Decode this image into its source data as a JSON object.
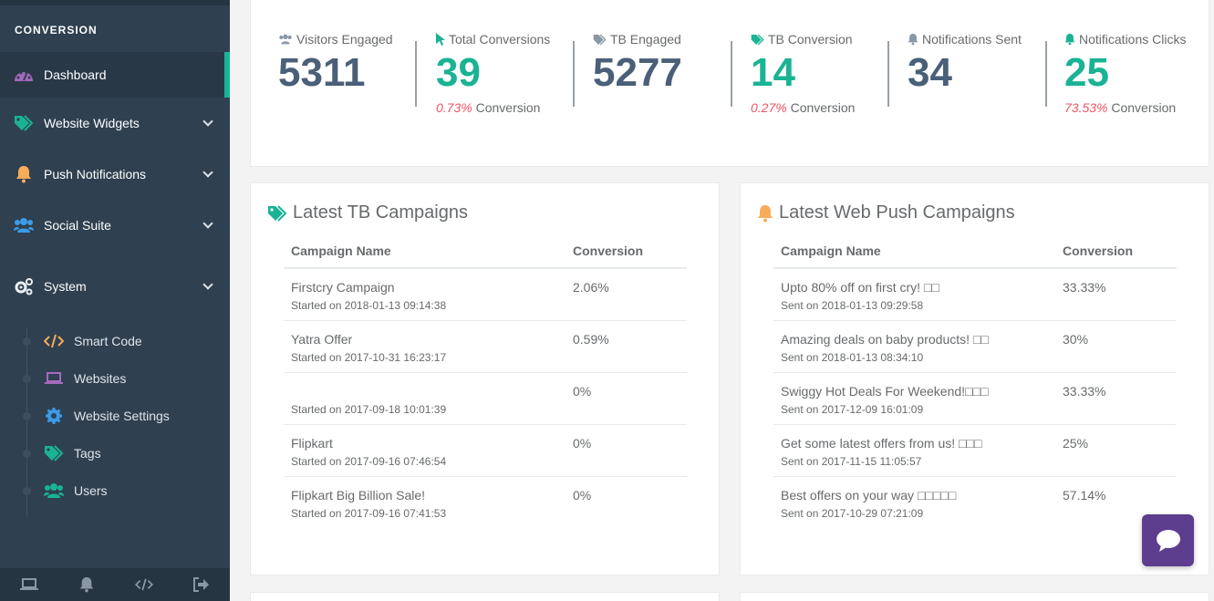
{
  "sidebar": {
    "section_title": "CONVERSION",
    "items": [
      {
        "label": "Dashboard"
      },
      {
        "label": "Website Widgets"
      },
      {
        "label": "Push Notifications"
      },
      {
        "label": "Social Suite"
      },
      {
        "label": "System"
      }
    ],
    "system_sub": [
      {
        "label": "Smart Code"
      },
      {
        "label": "Websites"
      },
      {
        "label": "Website Settings"
      },
      {
        "label": "Tags"
      },
      {
        "label": "Users"
      }
    ]
  },
  "stats": [
    {
      "label": "Visitors Engaged",
      "value": "5311",
      "pct": "",
      "sub": ""
    },
    {
      "label": "Total Conversions",
      "value": "39",
      "pct": "0.73%",
      "sub": "Conversion"
    },
    {
      "label": "TB Engaged",
      "value": "5277",
      "pct": "",
      "sub": ""
    },
    {
      "label": "TB Conversion",
      "value": "14",
      "pct": "0.27%",
      "sub": "Conversion"
    },
    {
      "label": "Notifications Sent",
      "value": "34",
      "pct": "",
      "sub": ""
    },
    {
      "label": "Notifications Clicks",
      "value": "25",
      "pct": "73.53%",
      "sub": "Conversion"
    }
  ],
  "tb_campaigns": {
    "title": "Latest TB Campaigns",
    "col_name": "Campaign Name",
    "col_conv": "Conversion",
    "rows": [
      {
        "name": "Firstcry Campaign",
        "date": "Started on 2018-01-13 09:14:38",
        "conv": "2.06%"
      },
      {
        "name": "Yatra Offer",
        "date": "Started on 2017-10-31 16:23:17",
        "conv": "0.59%"
      },
      {
        "name": "",
        "date": "Started on 2017-09-18 10:01:39",
        "conv": "0%"
      },
      {
        "name": "Flipkart",
        "date": "Started on 2017-09-16 07:46:54",
        "conv": "0%"
      },
      {
        "name": "Flipkart Big Billion Sale!",
        "date": "Started on 2017-09-16 07:41:53",
        "conv": "0%"
      }
    ]
  },
  "push_campaigns": {
    "title": "Latest Web Push Campaigns",
    "col_name": "Campaign Name",
    "col_conv": "Conversion",
    "rows": [
      {
        "name": "Upto 80% off on first cry! □□",
        "date": "Sent on 2018-01-13 09:29:58",
        "conv": "33.33%"
      },
      {
        "name": "Amazing deals on baby products! □□",
        "date": "Sent on 2018-01-13 08:34:10",
        "conv": "30%"
      },
      {
        "name": "Swiggy Hot Deals For Weekend!□□□",
        "date": "Sent on 2017-12-09 16:01:09",
        "conv": "33.33%"
      },
      {
        "name": "Get some latest offers from us! □□□",
        "date": "Sent on 2017-11-15 11:05:57",
        "conv": "25%"
      },
      {
        "name": "Best offers on your way □□□□□",
        "date": "Sent on 2017-10-29 07:21:09",
        "conv": "57.14%"
      }
    ]
  },
  "colors": {
    "sidebar_bg": "#2f4050",
    "accent": "#1ab394",
    "value_dark": "#4a5f78",
    "pct_red": "#ed5565",
    "chat_purple": "#5c3d8e"
  }
}
